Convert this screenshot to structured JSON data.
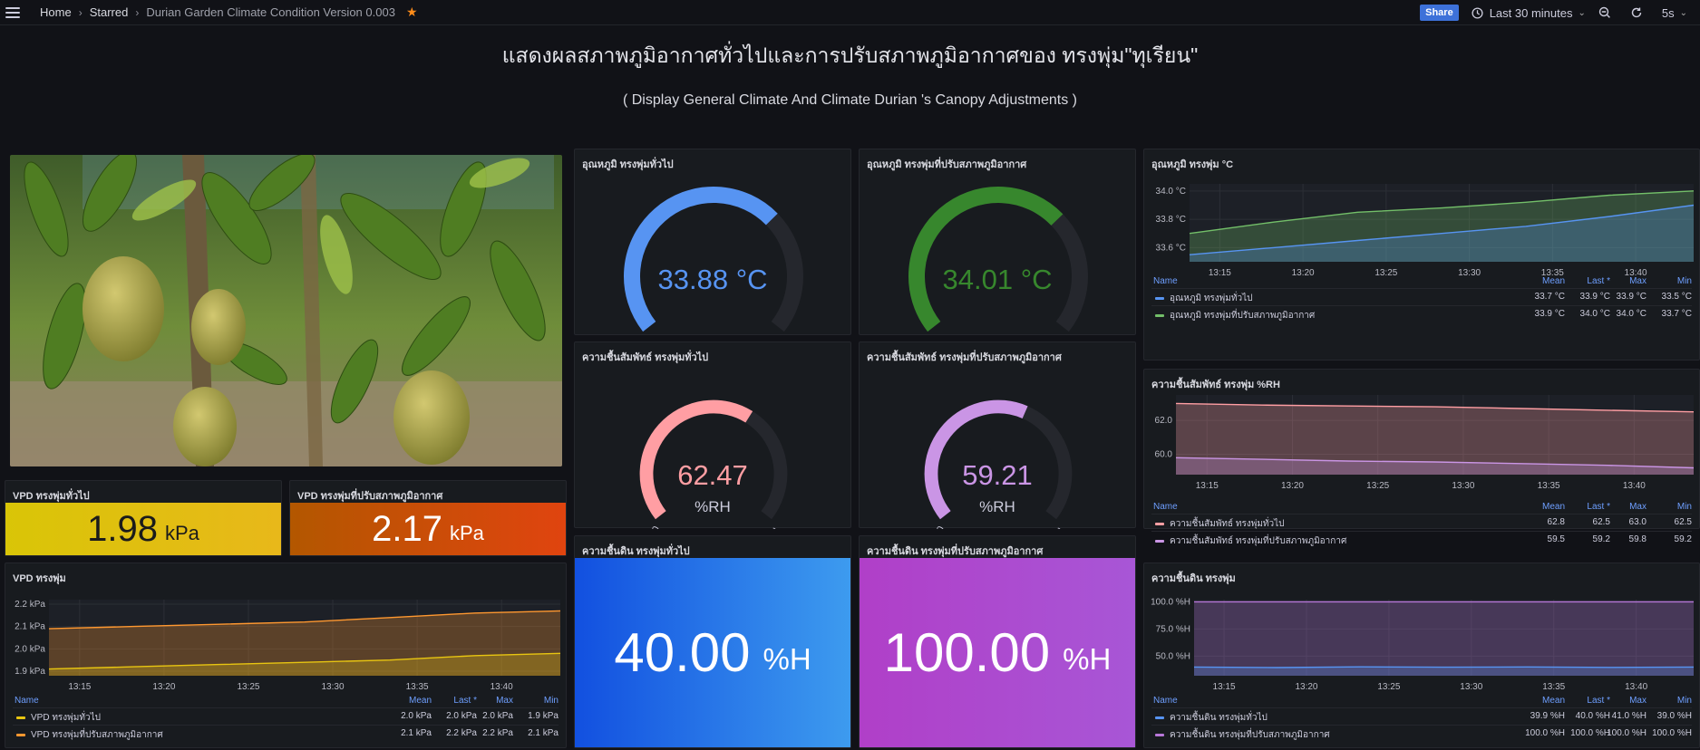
{
  "topbar": {
    "breadcrumbs": [
      "Home",
      "Starred"
    ],
    "dashboard_title": "Durian Garden Climate Condition Version 0.003",
    "share_label": "Share",
    "time_range": "Last 30 minutes",
    "refresh": "5s"
  },
  "header": {
    "title_th": "แสดงผลสภาพภูมิอากาศทั่วไปและการปรับสภาพภูมิอากาศของ ทรงพุ่ม\"ทุเรียน\"",
    "subtitle_en": "( Display General Climate And Climate Durian 's Canopy Adjustments )"
  },
  "legend_cols": {
    "name": "Name",
    "mean": "Mean",
    "last": "Last *",
    "max": "Max",
    "min": "Min"
  },
  "vpd_stats": {
    "general": {
      "title": "VPD ทรงพุ่มทั่วไป",
      "value": "1.98",
      "unit": "kPa",
      "color": "#e8c511"
    },
    "adjusted": {
      "title": "VPD ทรงพุ่มที่ปรับสภาพภูมิอากาศ",
      "value": "2.17",
      "unit": "kPa",
      "color": "#d9480f"
    }
  },
  "gauges": {
    "temp_general": {
      "title": "อุณหภูมิ ทรงพุ่มทั่วไป",
      "value": "33.88 °C",
      "min": "0",
      "max": "50",
      "fraction": 0.678,
      "color": "#5794f2"
    },
    "temp_adjusted": {
      "title": "อุณหภูมิ ทรงพุ่มที่ปรับสภาพภูมิอากาศ",
      "value": "34.01 °C",
      "min": "0",
      "max": "50",
      "fraction": 0.68,
      "color": "#37872d"
    },
    "rh_general": {
      "title": "ความชื้นสัมพัทธ์ ทรงพุ่มทั่วไป",
      "value": "62.47",
      "unit": "%RH",
      "min": "0",
      "max": "100",
      "fraction": 0.625,
      "color": "#ff9ea3"
    },
    "rh_adjusted": {
      "title": "ความชื้นสัมพัทธ์ ทรงพุ่มที่ปรับสภาพภูมิอากาศ",
      "value": "59.21",
      "unit": "%RH",
      "min": "0",
      "max": "100",
      "fraction": 0.592,
      "color": "#ca95e5"
    }
  },
  "soil_stats": {
    "general": {
      "title": "ความชื้นดิน ทรงพุ่มทั่วไป",
      "value": "40.00",
      "unit": "%H"
    },
    "adjusted": {
      "title": "ความชื้นดิน ทรงพุ่มที่ปรับสภาพภูมิอากาศ",
      "value": "100.00",
      "unit": "%H"
    }
  },
  "chart_data": [
    {
      "type": "area",
      "title": "อุณหภูมิ ทรงพุ่ม °C",
      "x": [
        "13:15",
        "13:20",
        "13:25",
        "13:30",
        "13:35",
        "13:40"
      ],
      "y_ticks": [
        "33.6 °C",
        "33.8 °C",
        "34.0 °C"
      ],
      "ylim": [
        33.5,
        34.05
      ],
      "series": [
        {
          "name": "อุณหภูมิ ทรงพุ่มทั่วไป",
          "color": "#5794f2",
          "values": [
            33.55,
            33.6,
            33.65,
            33.7,
            33.75,
            33.82,
            33.9
          ],
          "mean": "33.7 °C",
          "last": "33.9 °C",
          "max": "33.9 °C",
          "min": "33.5 °C"
        },
        {
          "name": "อุณหภูมิ ทรงพุ่มที่ปรับสภาพภูมิอากาศ",
          "color": "#73bf69",
          "values": [
            33.7,
            33.78,
            33.85,
            33.88,
            33.92,
            33.97,
            34.0
          ],
          "mean": "33.9 °C",
          "last": "34.0 °C",
          "max": "34.0 °C",
          "min": "33.7 °C"
        }
      ]
    },
    {
      "type": "area",
      "title": "ความชื้นสัมพัทธ์ ทรงพุ่ม %RH",
      "x": [
        "13:15",
        "13:20",
        "13:25",
        "13:30",
        "13:35",
        "13:40"
      ],
      "y_ticks": [
        "60.0",
        "62.0"
      ],
      "ylim": [
        58.8,
        63.5
      ],
      "series": [
        {
          "name": "ความชื้นสัมพัทธ์ ทรงพุ่มทั่วไป",
          "color": "#ff9ea3",
          "values": [
            63.0,
            62.9,
            62.85,
            62.8,
            62.7,
            62.6,
            62.5
          ],
          "mean": "62.8",
          "last": "62.5",
          "max": "63.0",
          "min": "62.5"
        },
        {
          "name": "ความชื้นสัมพัทธ์ ทรงพุ่มที่ปรับสภาพภูมิอากาศ",
          "color": "#ca95e5",
          "values": [
            59.8,
            59.7,
            59.6,
            59.55,
            59.45,
            59.35,
            59.2
          ],
          "mean": "59.5",
          "last": "59.2",
          "max": "59.8",
          "min": "59.2"
        }
      ]
    },
    {
      "type": "area",
      "title": "VPD ทรงพุ่ม",
      "x": [
        "13:15",
        "13:20",
        "13:25",
        "13:30",
        "13:35",
        "13:40"
      ],
      "y_ticks": [
        "1.9 kPa",
        "2.0 kPa",
        "2.1 kPa",
        "2.2 kPa"
      ],
      "ylim": [
        1.88,
        2.22
      ],
      "series": [
        {
          "name": "VPD ทรงพุ่มทั่วไป",
          "color": "#e8c511",
          "values": [
            1.91,
            1.92,
            1.93,
            1.94,
            1.95,
            1.97,
            1.98
          ],
          "mean": "2.0 kPa",
          "last": "2.0 kPa",
          "max": "2.0 kPa",
          "min": "1.9 kPa"
        },
        {
          "name": "VPD ทรงพุ่มที่ปรับสภาพภูมิอากาศ",
          "color": "#ff9830",
          "values": [
            2.09,
            2.1,
            2.11,
            2.12,
            2.14,
            2.16,
            2.17
          ],
          "mean": "2.1 kPa",
          "last": "2.2 kPa",
          "max": "2.2 kPa",
          "min": "2.1 kPa"
        }
      ]
    },
    {
      "type": "area",
      "title": "ความชื้นดิน ทรงพุ่ม",
      "x": [
        "13:15",
        "13:20",
        "13:25",
        "13:30",
        "13:35",
        "13:40"
      ],
      "y_ticks": [
        "50.0 %H",
        "75.0 %H",
        "100.0 %H"
      ],
      "ylim": [
        32,
        102
      ],
      "series": [
        {
          "name": "ความชื้นดิน ทรงพุ่มทั่วไป",
          "color": "#5794f2",
          "values": [
            40.0,
            39.5,
            40.2,
            39.8,
            40.1,
            39.7,
            40.0
          ],
          "mean": "39.9 %H",
          "last": "40.0 %H",
          "max": "41.0 %H",
          "min": "39.0 %H"
        },
        {
          "name": "ความชื้นดิน ทรงพุ่มที่ปรับสภาพภูมิอากาศ",
          "color": "#b877d9",
          "values": [
            100,
            100,
            100,
            100,
            100,
            100,
            100
          ],
          "mean": "100.0 %H",
          "last": "100.0 %H",
          "max": "100.0 %H",
          "min": "100.0 %H"
        }
      ]
    }
  ]
}
